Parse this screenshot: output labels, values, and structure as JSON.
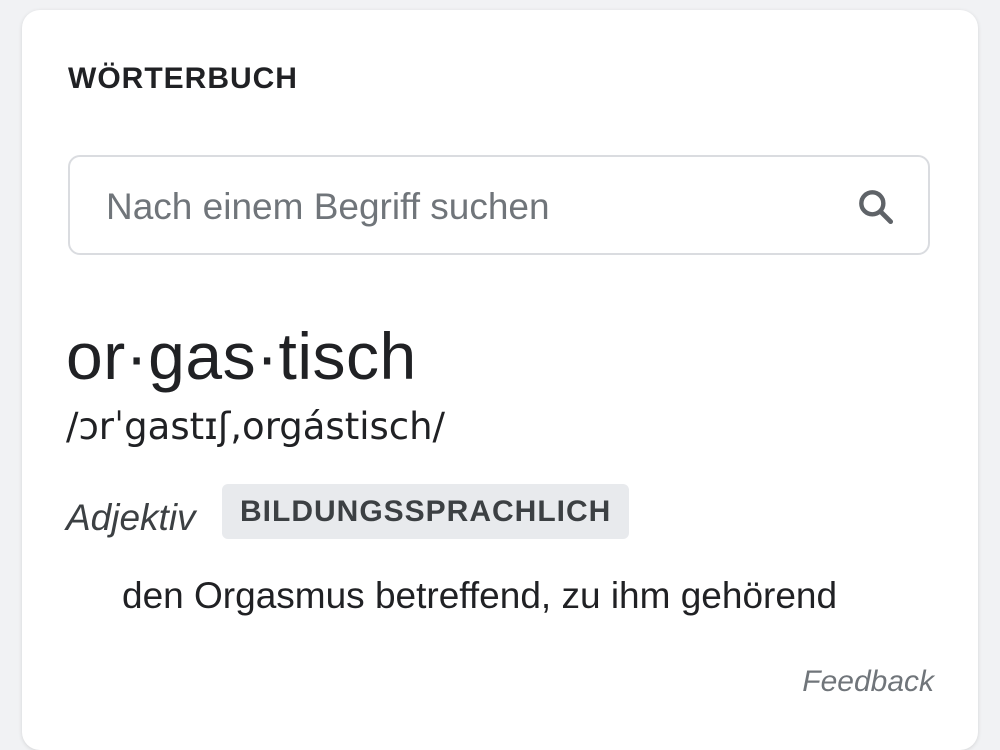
{
  "card": {
    "title": "WÖRTERBUCH"
  },
  "search": {
    "placeholder": "Nach einem Begriff suchen",
    "value": "",
    "icon": "search-icon"
  },
  "entry": {
    "headword": "or·gas·tisch",
    "pronunciation": "/ɔrˈgastɪʃ,orgástisch/",
    "part_of_speech": "Adjektiv",
    "register": "BILDUNGSSPRACHLICH",
    "definition": "den Orgasmus betreffend, zu ihm gehörend"
  },
  "footer": {
    "feedback_label": "Feedback"
  },
  "colors": {
    "text_primary": "#202124",
    "text_secondary": "#70757a",
    "badge_bg": "#e8eaed",
    "border": "#dadce0",
    "page_bg": "#f1f2f4"
  }
}
